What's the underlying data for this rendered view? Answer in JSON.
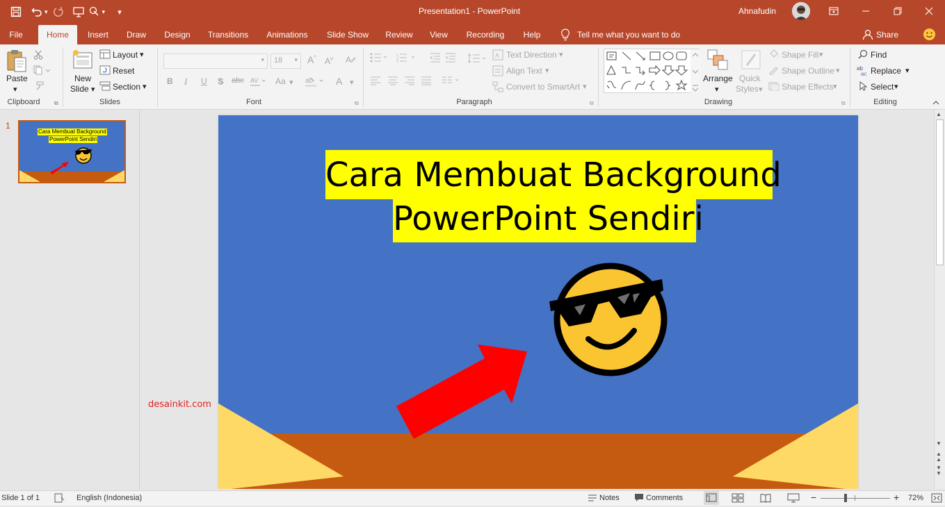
{
  "window": {
    "title": "Presentation1  -  PowerPoint",
    "user": "Ahnafudin"
  },
  "tabs": [
    "File",
    "Home",
    "Insert",
    "Draw",
    "Design",
    "Transitions",
    "Animations",
    "Slide Show",
    "Review",
    "View",
    "Recording",
    "Help"
  ],
  "active_tab": "Home",
  "tell_me": "Tell me what you want to do",
  "share": "Share",
  "ribbon": {
    "clipboard": {
      "label": "Clipboard",
      "paste": "Paste"
    },
    "slides": {
      "label": "Slides",
      "new_slide_1": "New",
      "new_slide_2": "Slide",
      "layout": "Layout",
      "reset": "Reset",
      "section": "Section"
    },
    "font": {
      "label": "Font",
      "size": "18",
      "bold": "B",
      "italic": "I",
      "underline": "U",
      "shadow": "S",
      "strike": "abc",
      "case": "Aa",
      "color": "A"
    },
    "paragraph": {
      "label": "Paragraph",
      "text_direction": "Text Direction",
      "align_text": "Align Text",
      "smartart": "Convert to SmartArt"
    },
    "drawing": {
      "label": "Drawing",
      "arrange": "Arrange",
      "quick_styles_1": "Quick",
      "quick_styles_2": "Styles",
      "shape_fill": "Shape Fill",
      "shape_outline": "Shape Outline",
      "shape_effects": "Shape Effects"
    },
    "editing": {
      "label": "Editing",
      "find": "Find",
      "replace": "Replace",
      "select": "Select"
    }
  },
  "thumbnail": {
    "number": "1",
    "title_line1": "Cara Membuat Background",
    "title_line2": "PowerPoint Sendiri"
  },
  "slide": {
    "title_line1": "Cara Membuat Background",
    "title_line2": "PowerPoint Sendiri",
    "colors": {
      "background": "#4472c4",
      "title_highlight": "#ffff00",
      "floor": "#c55a11",
      "corners": "#ffd966",
      "arrow": "#ff0000",
      "emoji": "#fbc532"
    }
  },
  "watermark": "desainkit.com",
  "status": {
    "slide_info": "Slide 1 of 1",
    "language": "English (Indonesia)",
    "notes": "Notes",
    "comments": "Comments",
    "zoom": "72%"
  }
}
